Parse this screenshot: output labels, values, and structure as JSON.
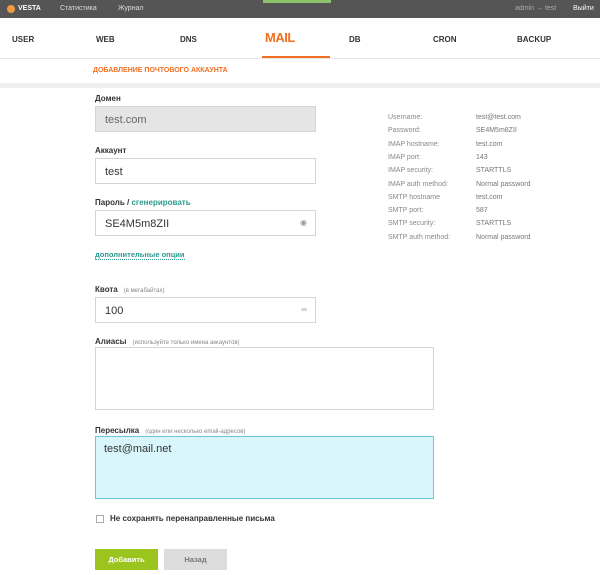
{
  "topbar": {
    "logo": "VESTA",
    "links": [
      "Статистика",
      "Журнал"
    ],
    "user": "admin → test",
    "logout": "Выйти"
  },
  "nav": {
    "tabs": [
      "USER",
      "WEB",
      "DNS",
      "MAIL",
      "DB",
      "CRON",
      "BACKUP"
    ],
    "active": "MAIL"
  },
  "subtitle": "ДОБАВЛЕНИЕ ПОЧТОВОГО АККАУНТА",
  "form": {
    "domain_label": "Домен",
    "domain_value": "test.com",
    "account_label": "Аккаунт",
    "account_value": "test",
    "password_label": "Пароль",
    "password_sep": " / ",
    "generate_link": "сгенерировать",
    "password_value": "SE4M5m8ZII",
    "advanced_link": "дополнительные опции",
    "quota_label": "Квота",
    "quota_hint": "(в мегабайтах)",
    "quota_value": "100",
    "quota_unlimited": "∞",
    "aliases_label": "Алиасы",
    "aliases_hint": "(используйте только имена аккаунтов)",
    "aliases_value": "",
    "forward_label": "Пересылка",
    "forward_hint": "(один или несколько email-адресов)",
    "forward_value": "test@mail.net",
    "no_store_label": "Не сохранять перенаправленные письма",
    "add_button": "Добавить",
    "back_button": "Назад"
  },
  "info": [
    {
      "k": "Username:",
      "v": "test@test.com"
    },
    {
      "k": "Password:",
      "v": "SE4M5m8ZII"
    },
    {
      "k": "IMAP hostname:",
      "v": "test.com"
    },
    {
      "k": "IMAP port:",
      "v": "143"
    },
    {
      "k": "IMAP security:",
      "v": "STARTTLS"
    },
    {
      "k": "IMAP auth method:",
      "v": "Normal password"
    },
    {
      "k": "SMTP hostname",
      "v": "test.com"
    },
    {
      "k": "SMTP port:",
      "v": "587"
    },
    {
      "k": "SMTP security:",
      "v": "STARTTLS"
    },
    {
      "k": "SMTP auth method:",
      "v": "Normal password"
    }
  ],
  "colors": {
    "accent": "#f26f21",
    "link": "#2c9a8f",
    "green": "#9cc41f"
  }
}
